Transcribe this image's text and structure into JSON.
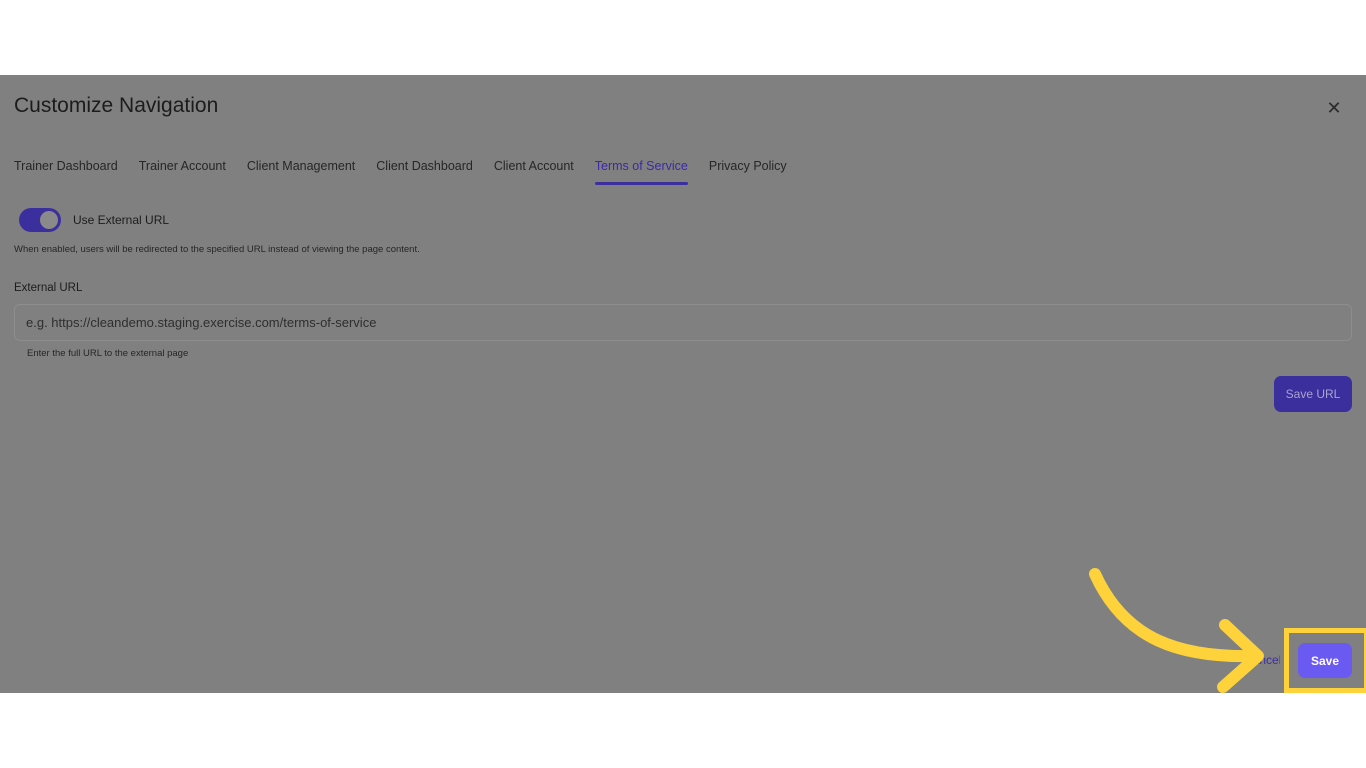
{
  "modal": {
    "title": "Customize Navigation",
    "close_icon": "close-icon"
  },
  "tabs": [
    {
      "label": "Trainer Dashboard"
    },
    {
      "label": "Trainer Account"
    },
    {
      "label": "Client Management"
    },
    {
      "label": "Client Dashboard"
    },
    {
      "label": "Client Account"
    },
    {
      "label": "Terms of Service",
      "active": true
    },
    {
      "label": "Privacy Policy"
    }
  ],
  "external_url_toggle": {
    "label": "Use External URL",
    "enabled": true,
    "help": "When enabled, users will be redirected to the specified URL instead of viewing the page content."
  },
  "external_url_field": {
    "label": "External URL",
    "value": "",
    "placeholder": "e.g. https://cleandemo.staging.exercise.com/terms-of-service",
    "help": "Enter the full URL to the external page"
  },
  "buttons": {
    "save_url": "Save URL",
    "cancel": "Cancel",
    "save": "Save"
  },
  "colors": {
    "accent": "#3b2f9e",
    "save_button": "#6a5af2",
    "highlight": "#fdd23b",
    "overlay": "#808080"
  },
  "annotation": {
    "arrow_icon": "curved-arrow-icon"
  }
}
